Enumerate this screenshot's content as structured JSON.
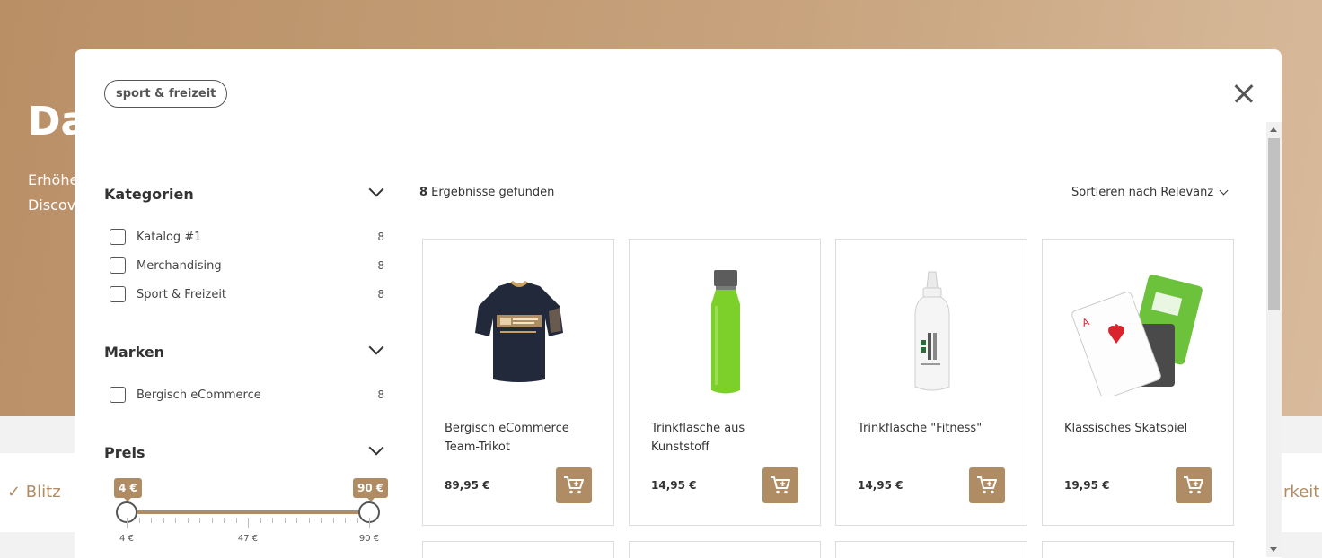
{
  "background": {
    "hero_title": "Da",
    "hero_line1": "Erhöhe",
    "hero_line2": "Discov",
    "usp_left": "✓ Blitz",
    "usp_right": "arkeit"
  },
  "modal": {
    "search_chip": "sport & freizeit",
    "close_icon": "close-icon"
  },
  "filters": {
    "kategorien": {
      "title": "Kategorien",
      "items": [
        {
          "label": "Katalog #1",
          "count": "8"
        },
        {
          "label": "Merchandising",
          "count": "8"
        },
        {
          "label": "Sport & Freizeit",
          "count": "8"
        }
      ]
    },
    "marken": {
      "title": "Marken",
      "items": [
        {
          "label": "Bergisch eCommerce",
          "count": "8"
        }
      ]
    },
    "preis": {
      "title": "Preis",
      "min_badge": "4 €",
      "max_badge": "90 €",
      "tick_min": "4 €",
      "tick_mid": "47 €",
      "tick_max": "90 €",
      "range_min": 4,
      "range_max": 90,
      "selected_min": 4,
      "selected_max": 90
    }
  },
  "results": {
    "count": "8",
    "count_suffix": " Ergebnisse gefunden",
    "sort_label": "Sortieren nach Relevanz",
    "products": [
      {
        "name": "Bergisch eCommerce Team-Trikot",
        "price": "89,95 €"
      },
      {
        "name": "Trinkflasche aus Kunststoff",
        "price": "14,95 €"
      },
      {
        "name": "Trinkflasche \"Fitness\"",
        "price": "14,95 €"
      },
      {
        "name": "Klassisches Skatspiel",
        "price": "19,95 €"
      }
    ]
  },
  "colors": {
    "accent": "#b08c64"
  }
}
